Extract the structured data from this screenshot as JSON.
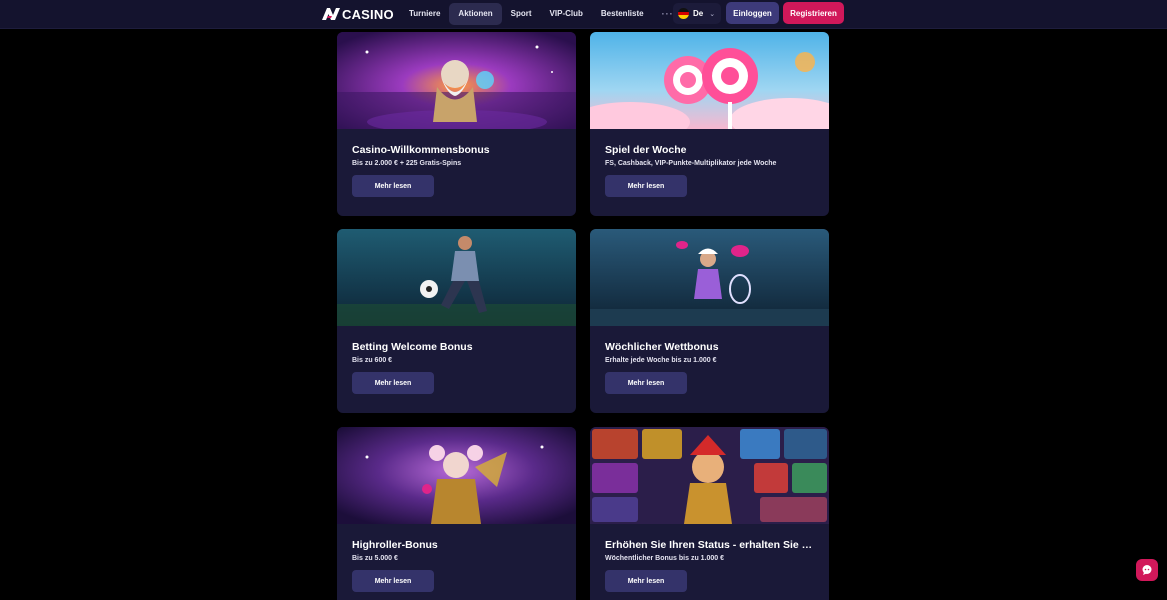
{
  "header": {
    "logo_text": "CASINO",
    "logo_mark": "AV-logo",
    "nav": [
      {
        "label": "Turniere",
        "active": false
      },
      {
        "label": "Aktionen",
        "active": true
      },
      {
        "label": "Sport",
        "active": false
      },
      {
        "label": "VIP-Club",
        "active": false
      },
      {
        "label": "Bestenliste",
        "active": false
      }
    ],
    "more_label": "···",
    "language": {
      "label": "De",
      "flag": "german-flag-icon"
    },
    "login_label": "Einloggen",
    "register_label": "Registrieren"
  },
  "promotions": [
    {
      "title": "Casino-Willkommensbonus",
      "subtitle": "Bis zu 2.000 € + 225 Gratis-Spins",
      "button": "Mehr lesen",
      "image": "zeus-casino-banner"
    },
    {
      "title": "Spiel der Woche",
      "subtitle": "FS, Cashback, VIP-Punkte-Multiplikator jede Woche",
      "button": "Mehr lesen",
      "image": "candy-lollipop-banner"
    },
    {
      "title": "Betting Welcome Bonus",
      "subtitle": "Bis zu 600 €",
      "button": "Mehr lesen",
      "image": "football-player-banner"
    },
    {
      "title": "Wöchlicher Wettbonus",
      "subtitle": "Erhalte jede Woche bis zu 1.000 €",
      "button": "Mehr lesen",
      "image": "tennis-player-banner"
    },
    {
      "title": "Highroller-Bonus",
      "subtitle": "Bis zu 5.000 €",
      "button": "Mehr lesen",
      "image": "jester-banner"
    },
    {
      "title": "Erhöhen Sie Ihren Status - erhalten Sie größ...",
      "subtitle": "Wöchentlicher Bonus bis zu 1.000 €",
      "button": "Mehr lesen",
      "image": "slot-games-collage-banner"
    }
  ],
  "colors": {
    "background": "#000000",
    "header": "#14132e",
    "card": "#1a1938",
    "button": "#34336a",
    "accent": "#d1185a",
    "login": "#3d3a7a"
  },
  "chat_icon": "chat-bubble-icon"
}
